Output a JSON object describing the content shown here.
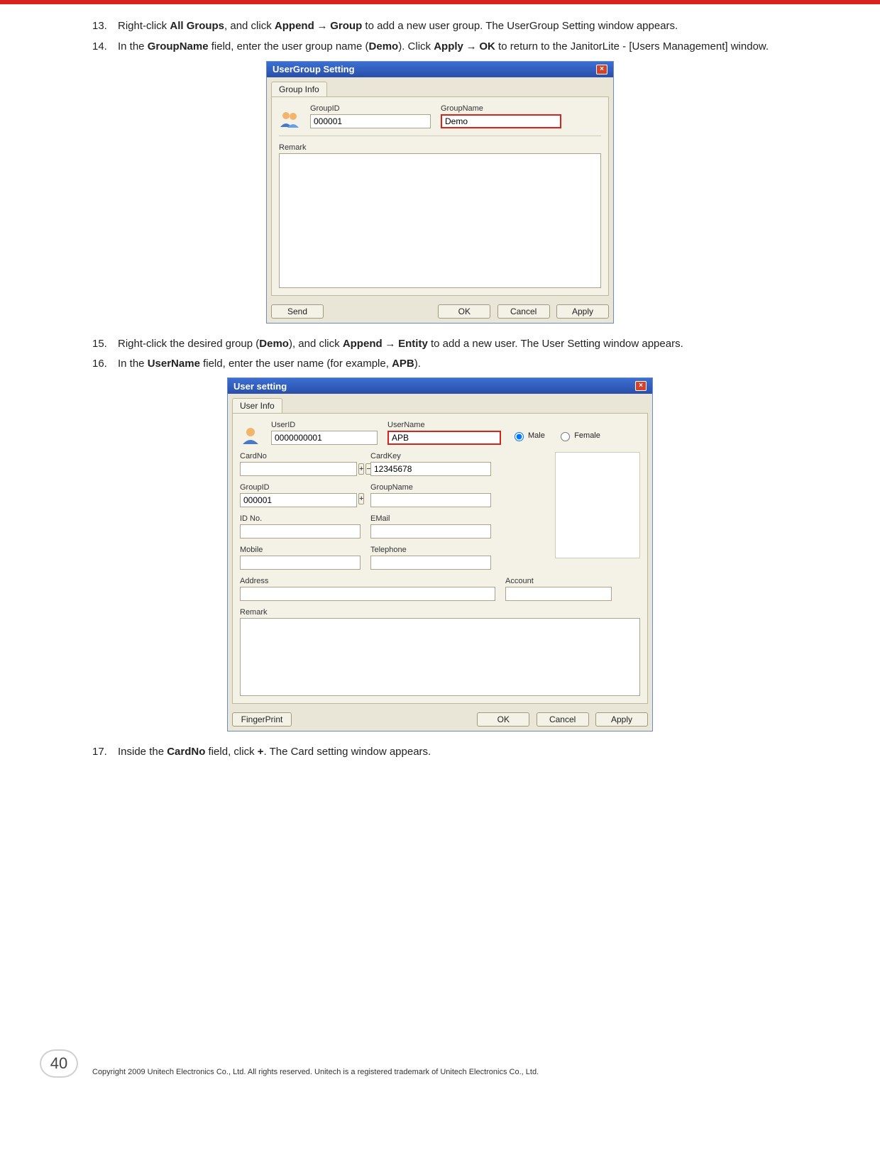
{
  "steps": {
    "s13": {
      "num": "13.",
      "text_parts": [
        "Right-click ",
        "All Groups",
        ", and click ",
        "Append",
        " → ",
        "Group",
        " to add a new user group. The UserGroup Setting window appears."
      ]
    },
    "s14": {
      "num": "14.",
      "text_parts": [
        "In the ",
        "GroupName",
        " field, enter the user group name (",
        "Demo",
        "). Click ",
        "Apply",
        " → ",
        "OK",
        " to return to the JanitorLite - [Users Management] window."
      ]
    },
    "s15": {
      "num": "15.",
      "text_parts": [
        "Right-click the desired group (",
        "Demo",
        "), and click ",
        "Append",
        " → ",
        "Entity",
        " to add a new user. The User Setting window appears."
      ]
    },
    "s16": {
      "num": "16.",
      "text_parts": [
        "In the ",
        "UserName",
        " field, enter the user name (for example, ",
        "APB",
        ")."
      ]
    },
    "s17": {
      "num": "17.",
      "text_parts": [
        "Inside the ",
        "CardNo",
        " field, click ",
        "+",
        ". The Card setting window appears."
      ]
    }
  },
  "dlg1": {
    "title": "UserGroup Setting",
    "tab": "Group Info",
    "groupid_label": "GroupID",
    "groupid_value": "000001",
    "groupname_label": "GroupName",
    "groupname_value": "Demo",
    "remark_label": "Remark",
    "remark_value": "",
    "buttons": {
      "send": "Send",
      "ok": "OK",
      "cancel": "Cancel",
      "apply": "Apply"
    }
  },
  "dlg2": {
    "title": "User setting",
    "tab": "User Info",
    "userid_label": "UserID",
    "userid_value": "0000000001",
    "username_label": "UserName",
    "username_value": "APB",
    "male_label": "Male",
    "female_label": "Female",
    "gender_selected": "male",
    "cardno_label": "CardNo",
    "cardno_value": "",
    "cardkey_label": "CardKey",
    "cardkey_value": "12345678",
    "groupid_label": "GroupID",
    "groupid_value": "000001",
    "groupname_label": "GroupName",
    "groupname_value": "",
    "idno_label": "ID No.",
    "idno_value": "",
    "email_label": "EMail",
    "email_value": "",
    "mobile_label": "Mobile",
    "mobile_value": "",
    "telephone_label": "Telephone",
    "telephone_value": "",
    "address_label": "Address",
    "address_value": "",
    "account_label": "Account",
    "account_value": "",
    "remark_label": "Remark",
    "remark_value": "",
    "buttons": {
      "fingerprint": "FingerPrint",
      "ok": "OK",
      "cancel": "Cancel",
      "apply": "Apply"
    }
  },
  "footer": {
    "page_number": "40",
    "copyright": "Copyright 2009 Unitech Electronics Co., Ltd. All rights reserved. Unitech is a registered trademark of Unitech Electronics Co., Ltd."
  },
  "icons": {
    "plus": "+",
    "minus": "−",
    "close": "×"
  }
}
